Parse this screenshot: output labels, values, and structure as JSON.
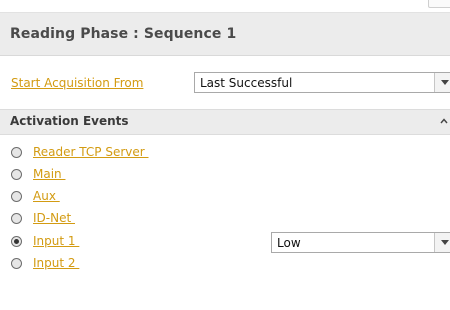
{
  "header": {
    "title": "Reading Phase :  Sequence 1"
  },
  "acquisition": {
    "label": "Start Acquisition From",
    "value": "Last Successful"
  },
  "section": {
    "title": "Activation Events"
  },
  "events": [
    {
      "label": "Reader TCP Server ",
      "checked": false
    },
    {
      "label": "Main ",
      "checked": false
    },
    {
      "label": "Aux ",
      "checked": false
    },
    {
      "label": "ID-Net ",
      "checked": false
    },
    {
      "label": "Input 1 ",
      "checked": true,
      "level": "Low"
    },
    {
      "label": "Input 2 ",
      "checked": false
    }
  ],
  "icons": {
    "dropdown": "chevron-down-icon",
    "collapse": "chevron-up-icon",
    "radio": "radio-button-icon"
  },
  "colors": {
    "link": "#d39b12",
    "header_bg": "#ececec",
    "section_bg": "#ececec"
  }
}
